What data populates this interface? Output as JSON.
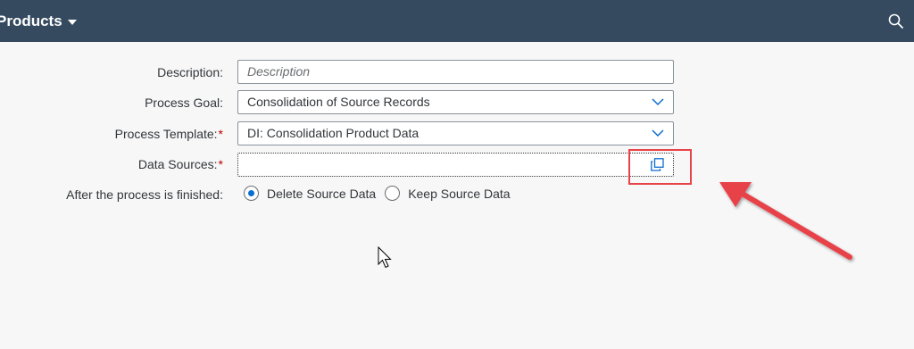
{
  "shellbar": {
    "title": "Products",
    "title_caret_icon": "caret-down-icon",
    "search_icon": "search-icon",
    "bg_color": "#354a5f"
  },
  "form": {
    "description": {
      "label": "Description:",
      "placeholder": "Description",
      "value": ""
    },
    "process_goal": {
      "label": "Process Goal:",
      "value": "Consolidation of Source Records",
      "icon": "chevron-down-icon"
    },
    "process_template": {
      "label": "Process Template:",
      "required_marker": "*",
      "value": "DI: Consolidation Product Data",
      "icon": "chevron-down-icon"
    },
    "data_sources": {
      "label": "Data Sources:",
      "required_marker": "*",
      "value": "",
      "icon": "value-help-icon"
    },
    "after_process": {
      "label": "After the process is finished:",
      "options": [
        {
          "label": "Delete Source Data",
          "selected": true
        },
        {
          "label": "Keep Source Data",
          "selected": false
        }
      ]
    }
  },
  "annotations": {
    "highlight_color": "#e8434a",
    "arrow_color": "#e8434a"
  }
}
